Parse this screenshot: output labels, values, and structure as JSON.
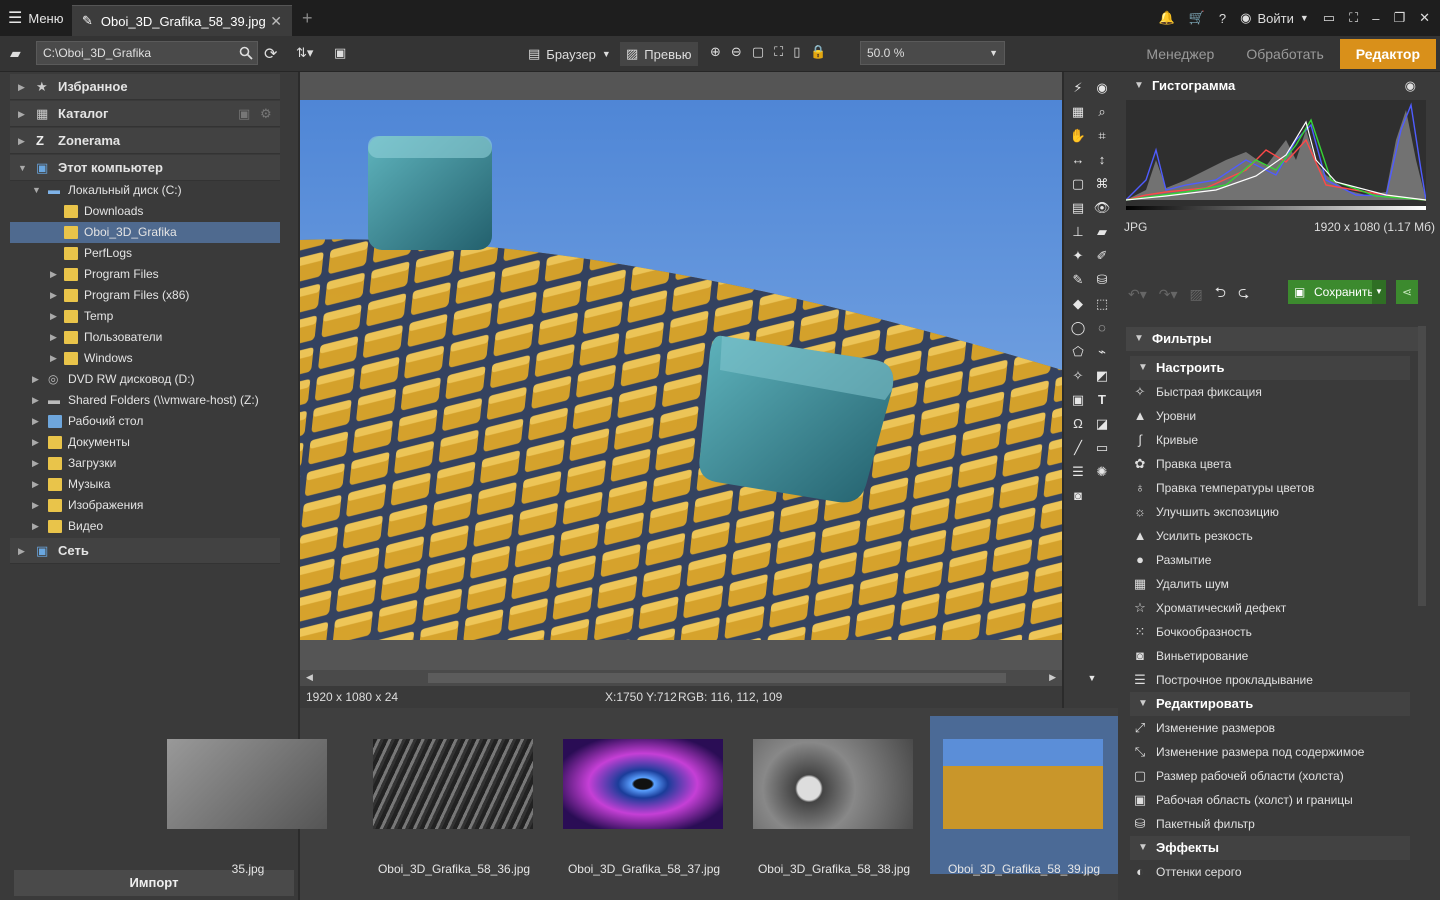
{
  "window": {
    "menu_label": "Меню",
    "tab_title": "Oboi_3D_Grafika_58_39.jpg",
    "login_label": "Войти"
  },
  "toolbar": {
    "path": "C:\\Oboi_3D_Grafika",
    "browser_label": "Браузер",
    "preview_label": "Превью",
    "zoom_value": "50.0 %",
    "modes": [
      "Менеджер",
      "Обработать",
      "Редактор"
    ],
    "active_mode": "Редактор"
  },
  "left_panel": {
    "sections": {
      "favorites": "Избранное",
      "catalog": "Каталог",
      "zonerama": "Zonerama",
      "this_pc": "Этот компьютер",
      "network": "Сеть"
    },
    "tree": [
      {
        "label": "Локальный диск (C:)"
      },
      {
        "label": "Downloads"
      },
      {
        "label": "Oboi_3D_Grafika",
        "selected": true
      },
      {
        "label": "PerfLogs"
      },
      {
        "label": "Program Files"
      },
      {
        "label": "Program Files (x86)"
      },
      {
        "label": "Temp"
      },
      {
        "label": "Пользователи"
      },
      {
        "label": "Windows"
      },
      {
        "label": "DVD RW дисковод (D:)"
      },
      {
        "label": "Shared Folders (\\\\vmware-host) (Z:)"
      },
      {
        "label": "Рабочий стол"
      },
      {
        "label": "Документы"
      },
      {
        "label": "Загрузки"
      },
      {
        "label": "Музыка"
      },
      {
        "label": "Изображения"
      },
      {
        "label": "Видео"
      }
    ],
    "import_label": "Импорт"
  },
  "status": {
    "dimensions": "1920 x 1080 x 24",
    "coords": "X:1750 Y:712",
    "rgb": "RGB: 116, 112, 109"
  },
  "filmstrip": [
    {
      "label": "35.jpg"
    },
    {
      "label": "Oboi_3D_Grafika_58_36.jpg"
    },
    {
      "label": "Oboi_3D_Grafika_58_37.jpg"
    },
    {
      "label": "Oboi_3D_Grafika_58_38.jpg"
    },
    {
      "label": "Oboi_3D_Grafika_58_39.jpg",
      "active": true
    }
  ],
  "right_panel": {
    "histogram_title": "Гистограмма",
    "file_type": "JPG",
    "file_info": "1920 x 1080 (1.17 Мб)",
    "save_label": "Сохранить",
    "filters_title": "Фильтры",
    "adjust_title": "Настроить",
    "adjust_items": [
      "Быстрая фиксация",
      "Уровни",
      "Кривые",
      "Правка цвета",
      "Правка температуры цветов",
      "Улучшить экспозицию",
      "Усилить резкость",
      "Размытие",
      "Удалить шум",
      "Хроматический дефект",
      "Бочкообразность",
      "Виньетирование",
      "Построчное прокладывание"
    ],
    "edit_title": "Редактировать",
    "edit_items": [
      "Изменение размеров",
      "Изменение размера под содержимое",
      "Размер рабочей области (холста)",
      "Рабочая область (холст) и границы",
      "Пакетный фильтр"
    ],
    "effects_title": "Эффекты",
    "effects_items": [
      "Оттенки серого"
    ]
  },
  "colors": {
    "accent": "#d9901a",
    "selection": "#4f6a8f",
    "save_green": "#3c8a2e"
  }
}
